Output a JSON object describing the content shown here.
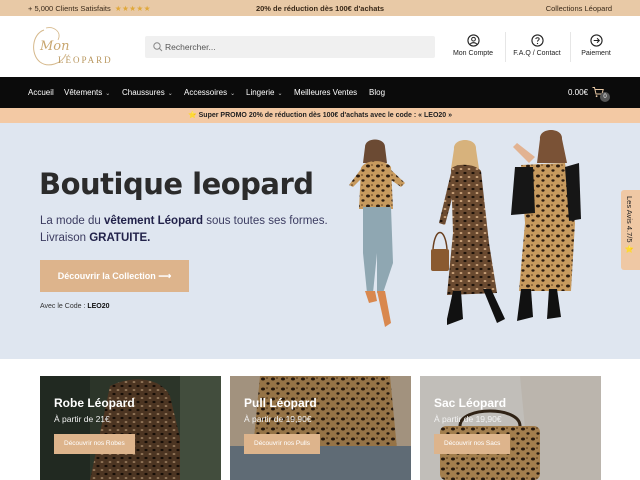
{
  "topbar": {
    "clients": "+ 5,000 Clients Satisfaits",
    "stars": "★★★★★",
    "promo": "20% de réduction dès 100€ d'achats",
    "collections": "Collections Léopard"
  },
  "logo": {
    "line1": "Mon",
    "line2": "LÉOPARD"
  },
  "search": {
    "placeholder": "Rechercher..."
  },
  "header_links": [
    {
      "label": "Mon Compte",
      "icon": "user-icon"
    },
    {
      "label": "F.A.Q / Contact",
      "icon": "help-icon"
    },
    {
      "label": "Paiement",
      "icon": "arrow-circle-icon"
    }
  ],
  "nav": {
    "items": [
      {
        "label": "Accueil"
      },
      {
        "label": "Vêtements"
      },
      {
        "label": "Chaussures"
      },
      {
        "label": "Accessoires"
      },
      {
        "label": "Lingerie"
      },
      {
        "label": "Meilleures Ventes"
      },
      {
        "label": "Blog"
      }
    ],
    "cart_amount": "0.00€",
    "cart_count": "0"
  },
  "promo_bar": {
    "prefix": "Super PROMO 20% de réduction dès 100€ d'achats avec le code : « LEO20 »"
  },
  "hero": {
    "title": "Boutique leopard",
    "sub_1": "La mode du ",
    "sub_bold": "vêtement Léopard",
    "sub_2": " sous toutes ses formes.",
    "sub_3": "Livraison ",
    "sub_bold2": "GRATUITE.",
    "cta": "Découvrir la Collection",
    "code_label": "Avec le Code : ",
    "code": "LEO20"
  },
  "reviews_tab": "Les Avis 4.7/5 ⭐",
  "cards": [
    {
      "title": "Robe Léopard",
      "price": "À partir de 21€",
      "button": "Découvrir nos Robes"
    },
    {
      "title": "Pull Léopard",
      "price": "À partir de 19,90€",
      "button": "Découvrir nos Pulls"
    },
    {
      "title": "Sac Léopard",
      "price": "À partir de 19,90€",
      "button": "Découvrir nos Sacs"
    }
  ],
  "colors": {
    "accent": "#ddb48c",
    "topbar": "#e8c9a6",
    "nav": "#0b0b0b",
    "hero_bg": "#dfe6f0"
  }
}
